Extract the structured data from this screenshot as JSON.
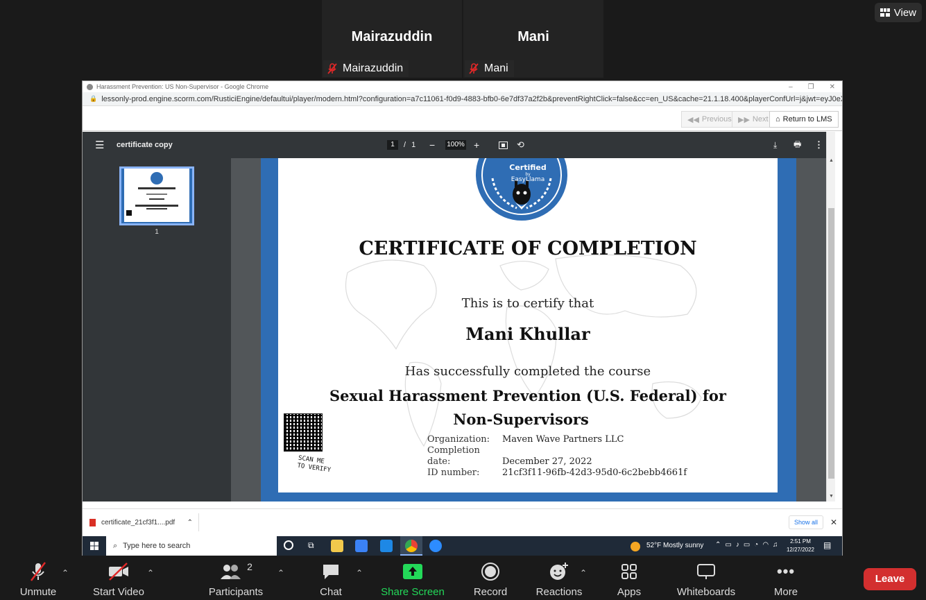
{
  "zoom": {
    "participants_tiles": [
      {
        "display_name": "Mairazuddin",
        "tag": "Mairazuddin"
      },
      {
        "display_name": "Mani",
        "tag": "Mani"
      }
    ],
    "view_label": "View",
    "toolbar": {
      "unmute": "Unmute",
      "start_video": "Start Video",
      "participants": "Participants",
      "participants_count": "2",
      "chat": "Chat",
      "share_screen": "Share Screen",
      "record": "Record",
      "reactions": "Reactions",
      "apps": "Apps",
      "whiteboards": "Whiteboards",
      "more": "More",
      "leave": "Leave"
    }
  },
  "chrome": {
    "window_title": "Harassment Prevention: US Non-Supervisor - Google Chrome",
    "url": "lessonly-prod.engine.scorm.com/RusticiEngine/defaultui/player/modern.html?configuration=a7c11061-f0d9-4883-bfb0-6e7df37a2f2b&preventRightClick=false&cc=en_US&cache=21.1.18.400&playerConfUrl=j&jwt=eyJ0eXAiOiJKV1QiLCJh...",
    "lms": {
      "previous": "Previous",
      "next": "Next",
      "return": "Return to LMS"
    }
  },
  "pdf": {
    "filename": "certificate copy",
    "page_current": "1",
    "page_sep": "/",
    "page_total": "1",
    "zoom": "100%",
    "thumb_label": "1"
  },
  "certificate": {
    "badge_line1": "Certified",
    "badge_line2": "by",
    "badge_line3": "EasyLlama",
    "title": "CERTIFICATE OF COMPLETION",
    "certify": "This is to certify that",
    "name": "Mani Khullar",
    "completed": "Has successfully completed the course",
    "course_line1": "Sexual Harassment Prevention (U.S. Federal) for",
    "course_line2": "Non-Supervisors",
    "org_label": "Organization:",
    "org_value": "Maven Wave Partners LLC",
    "date_label": "Completion date:",
    "date_value": "December 27, 2022",
    "id_label": "ID number:",
    "id_value": "21cf3f11-96fb-42d3-95d0-6c2bebb4661f",
    "scan_text1": "SCAN ME",
    "scan_text2": "TO VERIFY"
  },
  "downloads": {
    "file": "certificate_21cf3f1....pdf",
    "show_all": "Show all"
  },
  "taskbar": {
    "search_placeholder": "Type here to search",
    "weather": "52°F  Mostly sunny",
    "time": "2:51 PM",
    "date": "12/27/2022"
  },
  "colors": {
    "cert_blue": "#2f6db4",
    "share_green": "#23d959",
    "leave_red": "#d32f2f"
  }
}
